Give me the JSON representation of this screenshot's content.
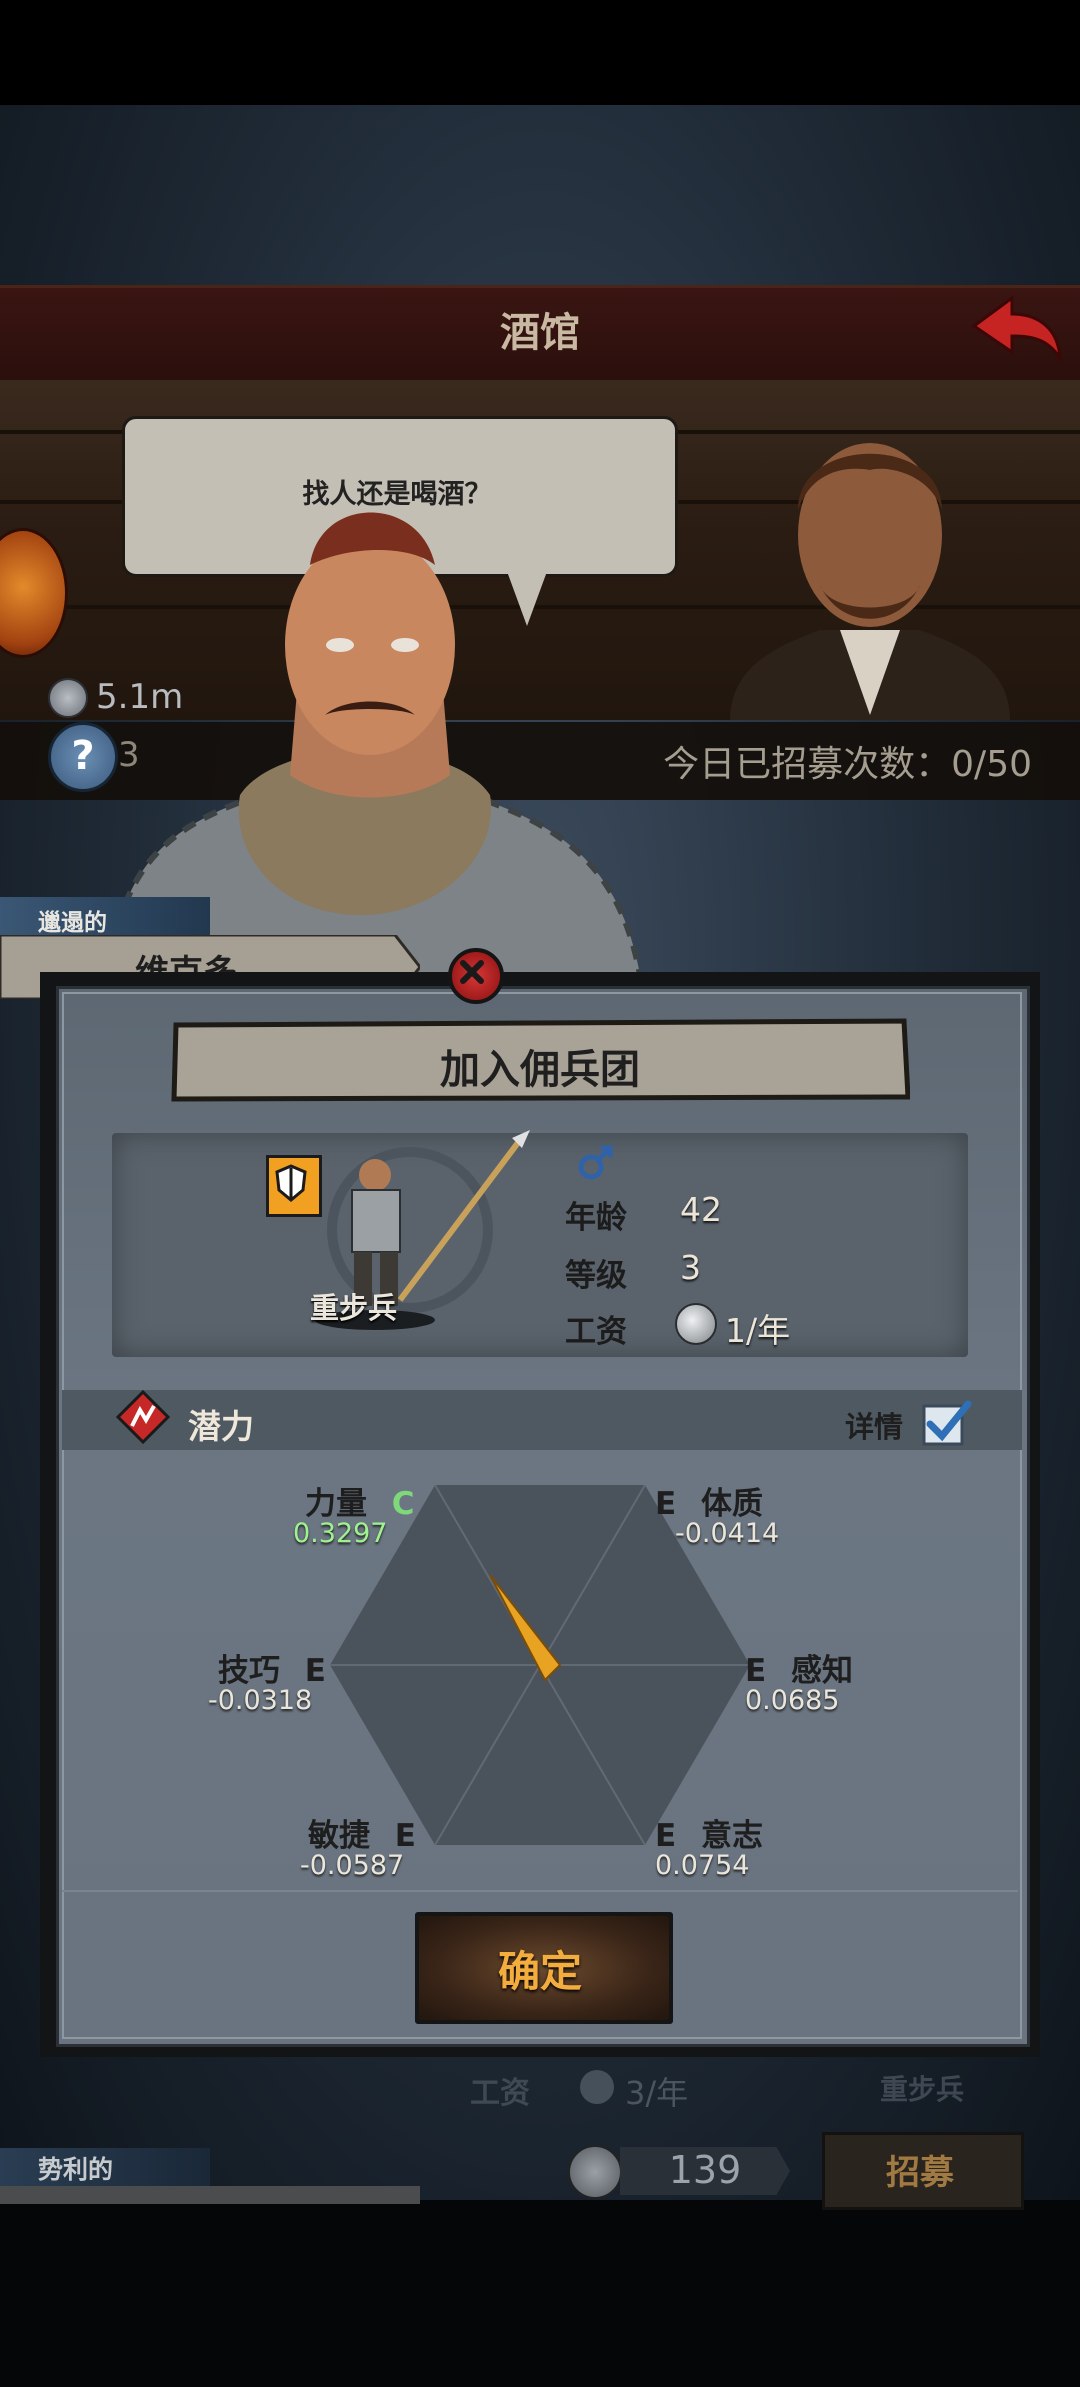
{
  "tavern": {
    "title": "酒馆",
    "speech": "找人还是喝酒？",
    "money": "5.1m",
    "count": "3",
    "recruit_count": "今日已招募次数：0/50"
  },
  "mercenary": {
    "title": "邋遢的",
    "name": "维克多"
  },
  "dialog": {
    "title": "加入佣兵团",
    "unit_class": "重步兵",
    "gender_icon": "male-icon",
    "stats": [
      {
        "label": "年龄",
        "value": "42"
      },
      {
        "label": "等级",
        "value": "3"
      },
      {
        "label": "工资",
        "value": "1/年"
      }
    ],
    "potential_label": "潜力",
    "details_label": "详情",
    "details_checked": true,
    "attributes": {
      "strength": {
        "label": "力量",
        "grade": "C",
        "value": "0.3297"
      },
      "constitution": {
        "label": "体质",
        "grade": "E",
        "value": "-0.0414"
      },
      "skill": {
        "label": "技巧",
        "grade": "E",
        "value": "-0.0318"
      },
      "perception": {
        "label": "感知",
        "grade": "E",
        "value": "0.0685"
      },
      "agility": {
        "label": "敏捷",
        "grade": "E",
        "value": "-0.0587"
      },
      "will": {
        "label": "意志",
        "grade": "E",
        "value": "0.0754"
      }
    },
    "confirm_label": "确定"
  },
  "background_list": {
    "wage_label": "工资",
    "wage_value": "3/年",
    "unit_class": "重步兵",
    "next_title": "势利的",
    "price": "139",
    "recruit_label": "招募"
  },
  "colors": {
    "accent_orange": "#f3ad3e",
    "grade_c_green": "#7fd87a",
    "close_red": "#d63636",
    "shield_orange": "#f1a021"
  }
}
